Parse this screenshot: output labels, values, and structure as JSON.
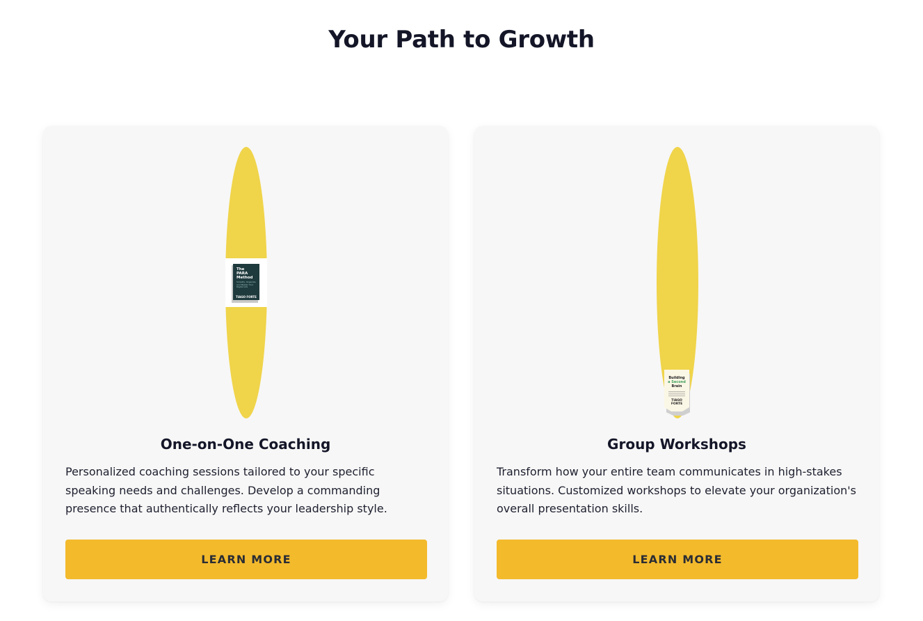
{
  "section": {
    "title": "Your Path to Growth"
  },
  "colors": {
    "accent_button": "#f3ba2c",
    "ellipse_yellow": "#f0d44a",
    "card_background": "#f7f7f7",
    "heading_text": "#141628"
  },
  "cards": [
    {
      "title": "One-on-One Coaching",
      "description": "Personalized coaching sessions tailored to your specific speaking needs and challenges. Develop a commanding presence that authentically reflects your leadership style.",
      "button_label": "LEARN MORE",
      "image": {
        "icon": "book-cover-icon",
        "cover_title_lines": [
          "The",
          "PARA",
          "Method"
        ],
        "cover_subtitle": "Simplify, Organize, and Master Your Digital Life",
        "cover_author": "TIAGO FORTE"
      }
    },
    {
      "title": "Group Workshops",
      "description": "Transform how your entire team communicates in high-stakes situations. Customized workshops to elevate your organization's overall presentation skills.",
      "button_label": "LEARN MORE",
      "image": {
        "icon": "book-cover-icon",
        "cover_title_lines": [
          "Building",
          "a Second",
          "Brain"
        ],
        "cover_author_lines": [
          "TIAGO",
          "FORTE"
        ]
      }
    }
  ]
}
